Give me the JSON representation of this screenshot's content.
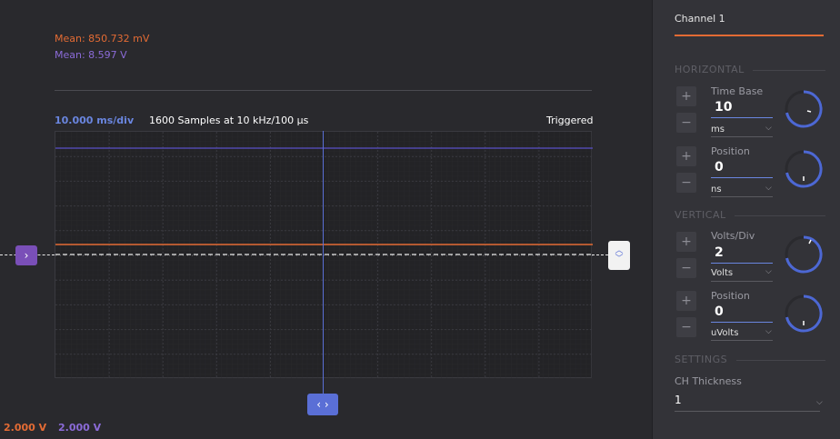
{
  "measurements": {
    "mean_ch1": "Mean: 850.732 mV",
    "mean_ch2": "Mean: 8.597 V"
  },
  "plot_header": {
    "time_per_div": "10.000 ms/div",
    "samples": "1600 Samples at 10 kHz/100 µs",
    "trigger_status": "Triggered"
  },
  "bottom_bar": {
    "ch1_scale": "2.000 V",
    "ch2_scale": "2.000 V"
  },
  "panel": {
    "tab": "Channel 1",
    "horizontal": {
      "title": "HORIZONTAL",
      "time_base": {
        "label": "Time Base",
        "value": "10",
        "unit": "ms"
      },
      "position": {
        "label": "Position",
        "value": "0",
        "unit": "ns"
      }
    },
    "vertical": {
      "title": "VERTICAL",
      "volts_div": {
        "label": "Volts/Div",
        "value": "2",
        "unit": "Volts"
      },
      "position": {
        "label": "Position",
        "value": "0",
        "unit": "uVolts"
      }
    },
    "settings": {
      "title": "SETTINGS",
      "thickness": {
        "label": "CH Thickness",
        "value": "1"
      }
    }
  },
  "colors": {
    "ch1": "#e36b34",
    "ch2": "#8b6bd8",
    "cursor": "#5a6fd6",
    "accent": "#e36b34"
  },
  "icons": {
    "plus": "+",
    "minus": "−",
    "chevron_down": "⌵",
    "chevron_right": "›",
    "chevrons_lr": "‹ ›"
  }
}
